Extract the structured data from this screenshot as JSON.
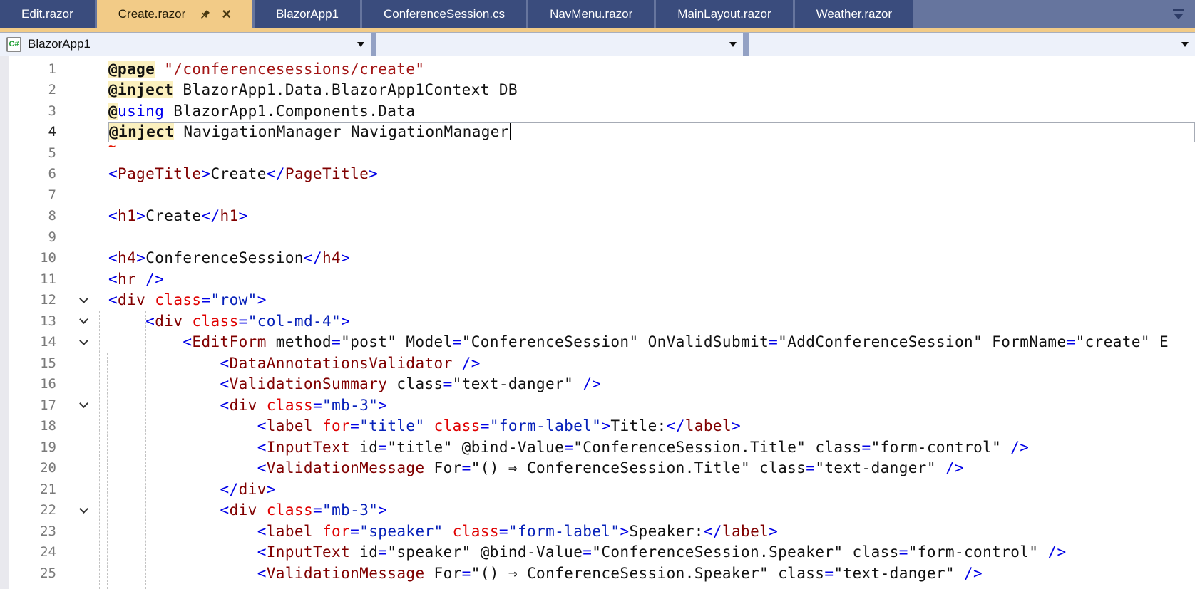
{
  "tabs": {
    "close_icon": "×",
    "items": [
      {
        "label": "Edit.razor",
        "active": false
      },
      {
        "label": "Create.razor",
        "active": true,
        "pinned": true,
        "closable": true
      },
      {
        "label": "BlazorApp1",
        "active": false
      },
      {
        "label": "ConferenceSession.cs",
        "active": false
      },
      {
        "label": "NavMenu.razor",
        "active": false
      },
      {
        "label": "MainLayout.razor",
        "active": false
      },
      {
        "label": "Weather.razor",
        "active": false
      }
    ]
  },
  "navbar": {
    "project_icon_text": "C#",
    "project_label": "BlazorApp1",
    "combo2_value": "",
    "combo3_value": ""
  },
  "colors": {
    "active_tab": "#F2CB87",
    "inactive_tab": "#3A4C7D",
    "tabbar_bg": "#66759E",
    "navbar_bg": "#EDF1FA",
    "tag_maroon": "#800000",
    "attr_red": "#E00000",
    "value_blue": "#0721B9",
    "string_red": "#A31515",
    "directive_highlight": "#FBF0BE"
  },
  "editor": {
    "lines": [
      {
        "n": 1,
        "tokens": [
          [
            "dir",
            "@page"
          ],
          [
            "txt",
            " "
          ],
          [
            "str",
            "\"/conferencesessions/create\""
          ]
        ]
      },
      {
        "n": 2,
        "tokens": [
          [
            "dir",
            "@inject"
          ],
          [
            "txt",
            " BlazorApp1.Data.BlazorApp1Context DB"
          ]
        ]
      },
      {
        "n": 3,
        "tokens": [
          [
            "dirat",
            "@"
          ],
          [
            "kw",
            "using"
          ],
          [
            "txt",
            " BlazorApp1.Components.Data"
          ]
        ]
      },
      {
        "n": 4,
        "current": true,
        "caret": true,
        "tokens": [
          [
            "dir",
            "@inject"
          ],
          [
            "txt",
            " NavigationManager NavigationManager"
          ]
        ]
      },
      {
        "n": 5,
        "tokens": [
          [
            "sq",
            "~"
          ]
        ]
      },
      {
        "n": 6,
        "tokens": [
          [
            "brk",
            "<"
          ],
          [
            "tag",
            "PageTitle"
          ],
          [
            "brk",
            ">"
          ],
          [
            "txt",
            "Create"
          ],
          [
            "brk",
            "</"
          ],
          [
            "tag",
            "PageTitle"
          ],
          [
            "brk",
            ">"
          ]
        ]
      },
      {
        "n": 7,
        "tokens": []
      },
      {
        "n": 8,
        "tokens": [
          [
            "brk",
            "<"
          ],
          [
            "tag",
            "h1"
          ],
          [
            "brk",
            ">"
          ],
          [
            "txt",
            "Create"
          ],
          [
            "brk",
            "</"
          ],
          [
            "tag",
            "h1"
          ],
          [
            "brk",
            ">"
          ]
        ]
      },
      {
        "n": 9,
        "tokens": []
      },
      {
        "n": 10,
        "tokens": [
          [
            "brk",
            "<"
          ],
          [
            "tag",
            "h4"
          ],
          [
            "brk",
            ">"
          ],
          [
            "txt",
            "ConferenceSession"
          ],
          [
            "brk",
            "</"
          ],
          [
            "tag",
            "h4"
          ],
          [
            "brk",
            ">"
          ]
        ]
      },
      {
        "n": 11,
        "tokens": [
          [
            "brk",
            "<"
          ],
          [
            "tag",
            "hr"
          ],
          [
            "txt",
            " "
          ],
          [
            "brk",
            "/>"
          ]
        ]
      },
      {
        "n": 12,
        "chevron": true,
        "tokens": [
          [
            "brk",
            "<"
          ],
          [
            "tag",
            "div"
          ],
          [
            "txt",
            " "
          ],
          [
            "attr",
            "class"
          ],
          [
            "eq",
            "="
          ],
          [
            "aval",
            "\"row\""
          ],
          [
            "brk",
            ">"
          ]
        ]
      },
      {
        "n": 13,
        "chevron": true,
        "tokens": [
          [
            "txt",
            "    "
          ],
          [
            "brk",
            "<"
          ],
          [
            "tag",
            "div"
          ],
          [
            "txt",
            " "
          ],
          [
            "attr",
            "class"
          ],
          [
            "eq",
            "="
          ],
          [
            "aval",
            "\"col-md-4\""
          ],
          [
            "brk",
            ">"
          ]
        ]
      },
      {
        "n": 14,
        "chevron": true,
        "tokens": [
          [
            "txt",
            "        "
          ],
          [
            "brk",
            "<"
          ],
          [
            "tag",
            "EditForm"
          ],
          [
            "txt",
            " method"
          ],
          [
            "eq",
            "="
          ],
          [
            "txt",
            "\"post\" Model"
          ],
          [
            "eq",
            "="
          ],
          [
            "txt",
            "\"ConferenceSession\" OnValidSubmit"
          ],
          [
            "eq",
            "="
          ],
          [
            "txt",
            "\"AddConferenceSession\" FormName"
          ],
          [
            "eq",
            "="
          ],
          [
            "txt",
            "\"create\" E"
          ]
        ]
      },
      {
        "n": 15,
        "tokens": [
          [
            "txt",
            "            "
          ],
          [
            "brk",
            "<"
          ],
          [
            "tag",
            "DataAnnotationsValidator"
          ],
          [
            "txt",
            " "
          ],
          [
            "brk",
            "/>"
          ]
        ]
      },
      {
        "n": 16,
        "tokens": [
          [
            "txt",
            "            "
          ],
          [
            "brk",
            "<"
          ],
          [
            "tag",
            "ValidationSummary"
          ],
          [
            "txt",
            " class"
          ],
          [
            "eq",
            "="
          ],
          [
            "txt",
            "\"text-danger\" "
          ],
          [
            "brk",
            "/>"
          ]
        ]
      },
      {
        "n": 17,
        "chevron": true,
        "tokens": [
          [
            "txt",
            "            "
          ],
          [
            "brk",
            "<"
          ],
          [
            "tag",
            "div"
          ],
          [
            "txt",
            " "
          ],
          [
            "attr",
            "class"
          ],
          [
            "eq",
            "="
          ],
          [
            "aval",
            "\"mb-3\""
          ],
          [
            "brk",
            ">"
          ]
        ]
      },
      {
        "n": 18,
        "tokens": [
          [
            "txt",
            "                "
          ],
          [
            "brk",
            "<"
          ],
          [
            "tag",
            "label"
          ],
          [
            "txt",
            " "
          ],
          [
            "attr",
            "for"
          ],
          [
            "eq",
            "="
          ],
          [
            "aval",
            "\"title\""
          ],
          [
            "txt",
            " "
          ],
          [
            "attr",
            "class"
          ],
          [
            "eq",
            "="
          ],
          [
            "aval",
            "\"form-label\""
          ],
          [
            "brk",
            ">"
          ],
          [
            "txt",
            "Title:"
          ],
          [
            "brk",
            "</"
          ],
          [
            "tag",
            "label"
          ],
          [
            "brk",
            ">"
          ]
        ]
      },
      {
        "n": 19,
        "tokens": [
          [
            "txt",
            "                "
          ],
          [
            "brk",
            "<"
          ],
          [
            "tag",
            "InputText"
          ],
          [
            "txt",
            " id"
          ],
          [
            "eq",
            "="
          ],
          [
            "txt",
            "\"title\" @bind-Value"
          ],
          [
            "eq",
            "="
          ],
          [
            "txt",
            "\"ConferenceSession.Title\" class"
          ],
          [
            "eq",
            "="
          ],
          [
            "txt",
            "\"form-control\" "
          ],
          [
            "brk",
            "/>"
          ]
        ]
      },
      {
        "n": 20,
        "tokens": [
          [
            "txt",
            "                "
          ],
          [
            "brk",
            "<"
          ],
          [
            "tag",
            "ValidationMessage"
          ],
          [
            "txt",
            " For"
          ],
          [
            "eq",
            "="
          ],
          [
            "txt",
            "\"() ⇒ ConferenceSession.Title\" class"
          ],
          [
            "eq",
            "="
          ],
          [
            "txt",
            "\"text-danger\" "
          ],
          [
            "brk",
            "/>"
          ]
        ]
      },
      {
        "n": 21,
        "tokens": [
          [
            "txt",
            "            "
          ],
          [
            "brk",
            "</"
          ],
          [
            "tag",
            "div"
          ],
          [
            "brk",
            ">"
          ]
        ]
      },
      {
        "n": 22,
        "chevron": true,
        "tokens": [
          [
            "txt",
            "            "
          ],
          [
            "brk",
            "<"
          ],
          [
            "tag",
            "div"
          ],
          [
            "txt",
            " "
          ],
          [
            "attr",
            "class"
          ],
          [
            "eq",
            "="
          ],
          [
            "aval",
            "\"mb-3\""
          ],
          [
            "brk",
            ">"
          ]
        ]
      },
      {
        "n": 23,
        "tokens": [
          [
            "txt",
            "                "
          ],
          [
            "brk",
            "<"
          ],
          [
            "tag",
            "label"
          ],
          [
            "txt",
            " "
          ],
          [
            "attr",
            "for"
          ],
          [
            "eq",
            "="
          ],
          [
            "aval",
            "\"speaker\""
          ],
          [
            "txt",
            " "
          ],
          [
            "attr",
            "class"
          ],
          [
            "eq",
            "="
          ],
          [
            "aval",
            "\"form-label\""
          ],
          [
            "brk",
            ">"
          ],
          [
            "txt",
            "Speaker:"
          ],
          [
            "brk",
            "</"
          ],
          [
            "tag",
            "label"
          ],
          [
            "brk",
            ">"
          ]
        ]
      },
      {
        "n": 24,
        "tokens": [
          [
            "txt",
            "                "
          ],
          [
            "brk",
            "<"
          ],
          [
            "tag",
            "InputText"
          ],
          [
            "txt",
            " id"
          ],
          [
            "eq",
            "="
          ],
          [
            "txt",
            "\"speaker\" @bind-Value"
          ],
          [
            "eq",
            "="
          ],
          [
            "txt",
            "\"ConferenceSession.Speaker\" class"
          ],
          [
            "eq",
            "="
          ],
          [
            "txt",
            "\"form-control\" "
          ],
          [
            "brk",
            "/>"
          ]
        ]
      },
      {
        "n": 25,
        "tokens": [
          [
            "txt",
            "                "
          ],
          [
            "brk",
            "<"
          ],
          [
            "tag",
            "ValidationMessage"
          ],
          [
            "txt",
            " For"
          ],
          [
            "eq",
            "="
          ],
          [
            "txt",
            "\"() ⇒ ConferenceSession.Speaker\" class"
          ],
          [
            "eq",
            "="
          ],
          [
            "txt",
            "\"text-danger\" "
          ],
          [
            "brk",
            "/>"
          ]
        ]
      }
    ]
  }
}
